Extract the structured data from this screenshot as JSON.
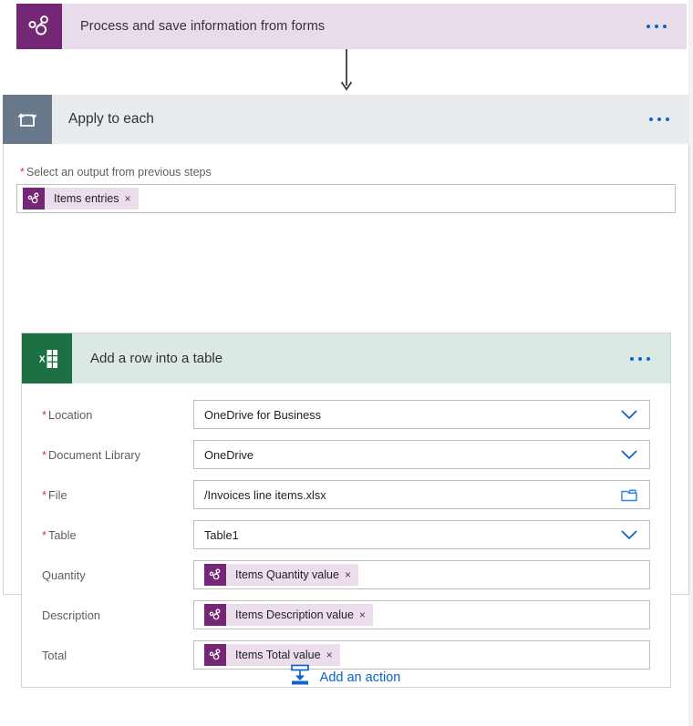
{
  "trigger": {
    "title": "Process and save information from forms",
    "icon": "forms-icon",
    "menu_icon": "ellipsis-icon",
    "color": "#e8dcea",
    "icon_color": "#742774"
  },
  "connector": {
    "icon": "down-arrow-icon"
  },
  "loop": {
    "title": "Apply to each",
    "icon": "loop-icon",
    "menu_icon": "ellipsis-icon",
    "header_color": "#e8ecef",
    "icon_color": "#69788a",
    "output_field": {
      "required_marker": "*",
      "label": "Select an output from previous steps",
      "token": {
        "label": "Items entries",
        "remove_icon": "close-icon",
        "remove_label": "×",
        "icon": "forms-icon"
      }
    }
  },
  "action": {
    "title": "Add a row into a table",
    "icon": "excel-icon",
    "menu_icon": "ellipsis-icon",
    "header_color": "#dce9e2",
    "icon_color": "#1d7044",
    "fields": [
      {
        "required_marker": "*",
        "required": true,
        "label": "Location",
        "type": "dropdown",
        "value": "OneDrive for Business",
        "control_icon": "chevron-down-icon"
      },
      {
        "required_marker": "*",
        "required": true,
        "label": "Document Library",
        "type": "dropdown",
        "value": "OneDrive",
        "control_icon": "chevron-down-icon"
      },
      {
        "required_marker": "*",
        "required": true,
        "label": "File",
        "type": "file-picker",
        "value": "/Invoices line items.xlsx",
        "control_icon": "folder-icon"
      },
      {
        "required_marker": "*",
        "required": true,
        "label": "Table",
        "type": "dropdown",
        "value": "Table1",
        "control_icon": "chevron-down-icon"
      },
      {
        "required_marker": "",
        "required": false,
        "label": "Quantity",
        "type": "token",
        "token": {
          "label": "Items Quantity value",
          "remove_label": "×",
          "icon": "forms-icon"
        }
      },
      {
        "required_marker": "",
        "required": false,
        "label": "Description",
        "type": "token",
        "token": {
          "label": "Items Description value",
          "remove_label": "×",
          "icon": "forms-icon"
        }
      },
      {
        "required_marker": "",
        "required": false,
        "label": "Total",
        "type": "token",
        "token": {
          "label": "Items Total value",
          "remove_label": "×",
          "icon": "forms-icon"
        }
      }
    ]
  },
  "footer": {
    "add_action_label": "Add an action",
    "add_action_icon": "insert-step-icon",
    "accent_color": "#0b63ce"
  }
}
